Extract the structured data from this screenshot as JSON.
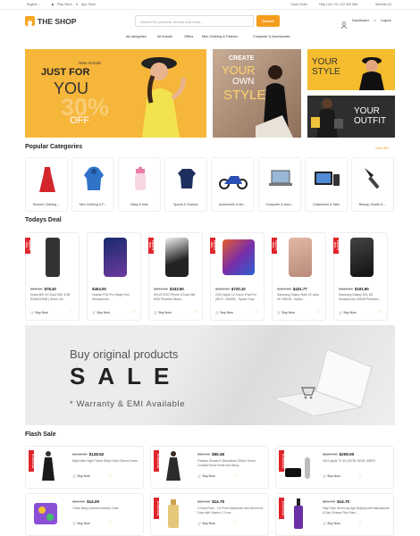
{
  "topbar": {
    "language": "English ⌄",
    "play_store": "Play Store",
    "app_store": "App Store",
    "track_order": "Track Order",
    "help": "Help Line +01 112 352 566",
    "wishlist": "Wishlist (0)"
  },
  "header": {
    "logo": "THE SHOP",
    "search_placeholder": "Search for products, brands and more...",
    "search_button": "Search",
    "dashboard": "Dashboard",
    "or": "or",
    "logout": "Logout"
  },
  "nav": [
    "All categories",
    "All brands",
    "Offers",
    "Men Clothing & Fashion",
    "Computer & Accessories"
  ],
  "banners": {
    "main_small": "New Arrivals",
    "main_title": "JUST FOR",
    "main_you": "YOU",
    "main_pct": "30%",
    "main_off": "OFF",
    "mid": [
      "CREATE",
      "YOUR",
      "OWN",
      "STYLE"
    ],
    "right_top": [
      "YOUR",
      "STYLE"
    ],
    "right_bottom": [
      "YOUR",
      "OUTFIT"
    ]
  },
  "categories": {
    "title": "Popular Categories",
    "view_all": "View All ›",
    "items": [
      {
        "label": "Women Clothing ..."
      },
      {
        "label": "Men Clothing & F..."
      },
      {
        "label": "Baby & Kids"
      },
      {
        "label": "Sports & Outdoor"
      },
      {
        "label": "Automobile & Mo..."
      },
      {
        "label": "Computer & Acce..."
      },
      {
        "label": "Cellphones & Tabs"
      },
      {
        "label": "Beauty, Health & ..."
      }
    ]
  },
  "deals": {
    "title": "Todays Deal",
    "tag": "TODAY'S DEAL",
    "buy": "Buy Now",
    "items": [
      {
        "old": "$88.00",
        "price": "$78.40",
        "name": "Nokia 800 4G Dual SIM, 4GB RAM/512MB | Storm Ge..."
      },
      {
        "old": "",
        "price": "$404.00",
        "name": "Huawei P30 Pro Single Sim Smartphone..."
      },
      {
        "old": "$391.00",
        "price": "$333.50",
        "name": "ASUS ROG Phone 5 Dual SIM 8GB Phantom Black..."
      },
      {
        "old": "$848.00",
        "price": "$720.10",
        "name": "2021 Apple 12.9-inch iPad Pro (Wi-Fi, 256GB) - Space Gray"
      },
      {
        "old": "$454.00",
        "price": "$431.77",
        "name": "Samsung Galaxy Note 20 Ultra 5G 256GB - Mystic..."
      },
      {
        "old": "$232.00",
        "price": "$191.90",
        "name": "Samsung Galaxy S21 5G Smartphone 128GB Phantom..."
      }
    ]
  },
  "sale_banner": {
    "line1": "Buy original products",
    "line2": "SALE",
    "line3": "* Warranty & EMI Available"
  },
  "flash": {
    "title": "Flash Sale",
    "tag": "FLASH SALE",
    "buy": "Buy Now",
    "items": [
      {
        "old": "$142.00",
        "price": "$128.52",
        "name": "Night After Night Tiered Stripe Short Sleeve Dress"
      },
      {
        "old": "$58.00",
        "price": "$50.49",
        "name": "Parisian Women's Sleeveless Chiffon Tiered Cocktail Dress Petite and Missy"
      },
      {
        "old": "$220.00",
        "price": "$209.00",
        "name": "2021 Apple TV 4K (32GB, 64GB 1080P)"
      },
      {
        "old": "$15.00",
        "price": "$14.00",
        "name": "VTech Baby Learners Activity Cube"
      },
      {
        "old": "$18.00",
        "price": "$14.75",
        "name": "L'Oreal Paris - 1% Pure Hyaluronic acid Serum for Face with Vitamin C Crea..."
      },
      {
        "old": "$18.00",
        "price": "$14.70",
        "name": "Olay Face Serum by Age Defying with Niacinamide & Day Cleaner Plus Face..."
      }
    ]
  }
}
